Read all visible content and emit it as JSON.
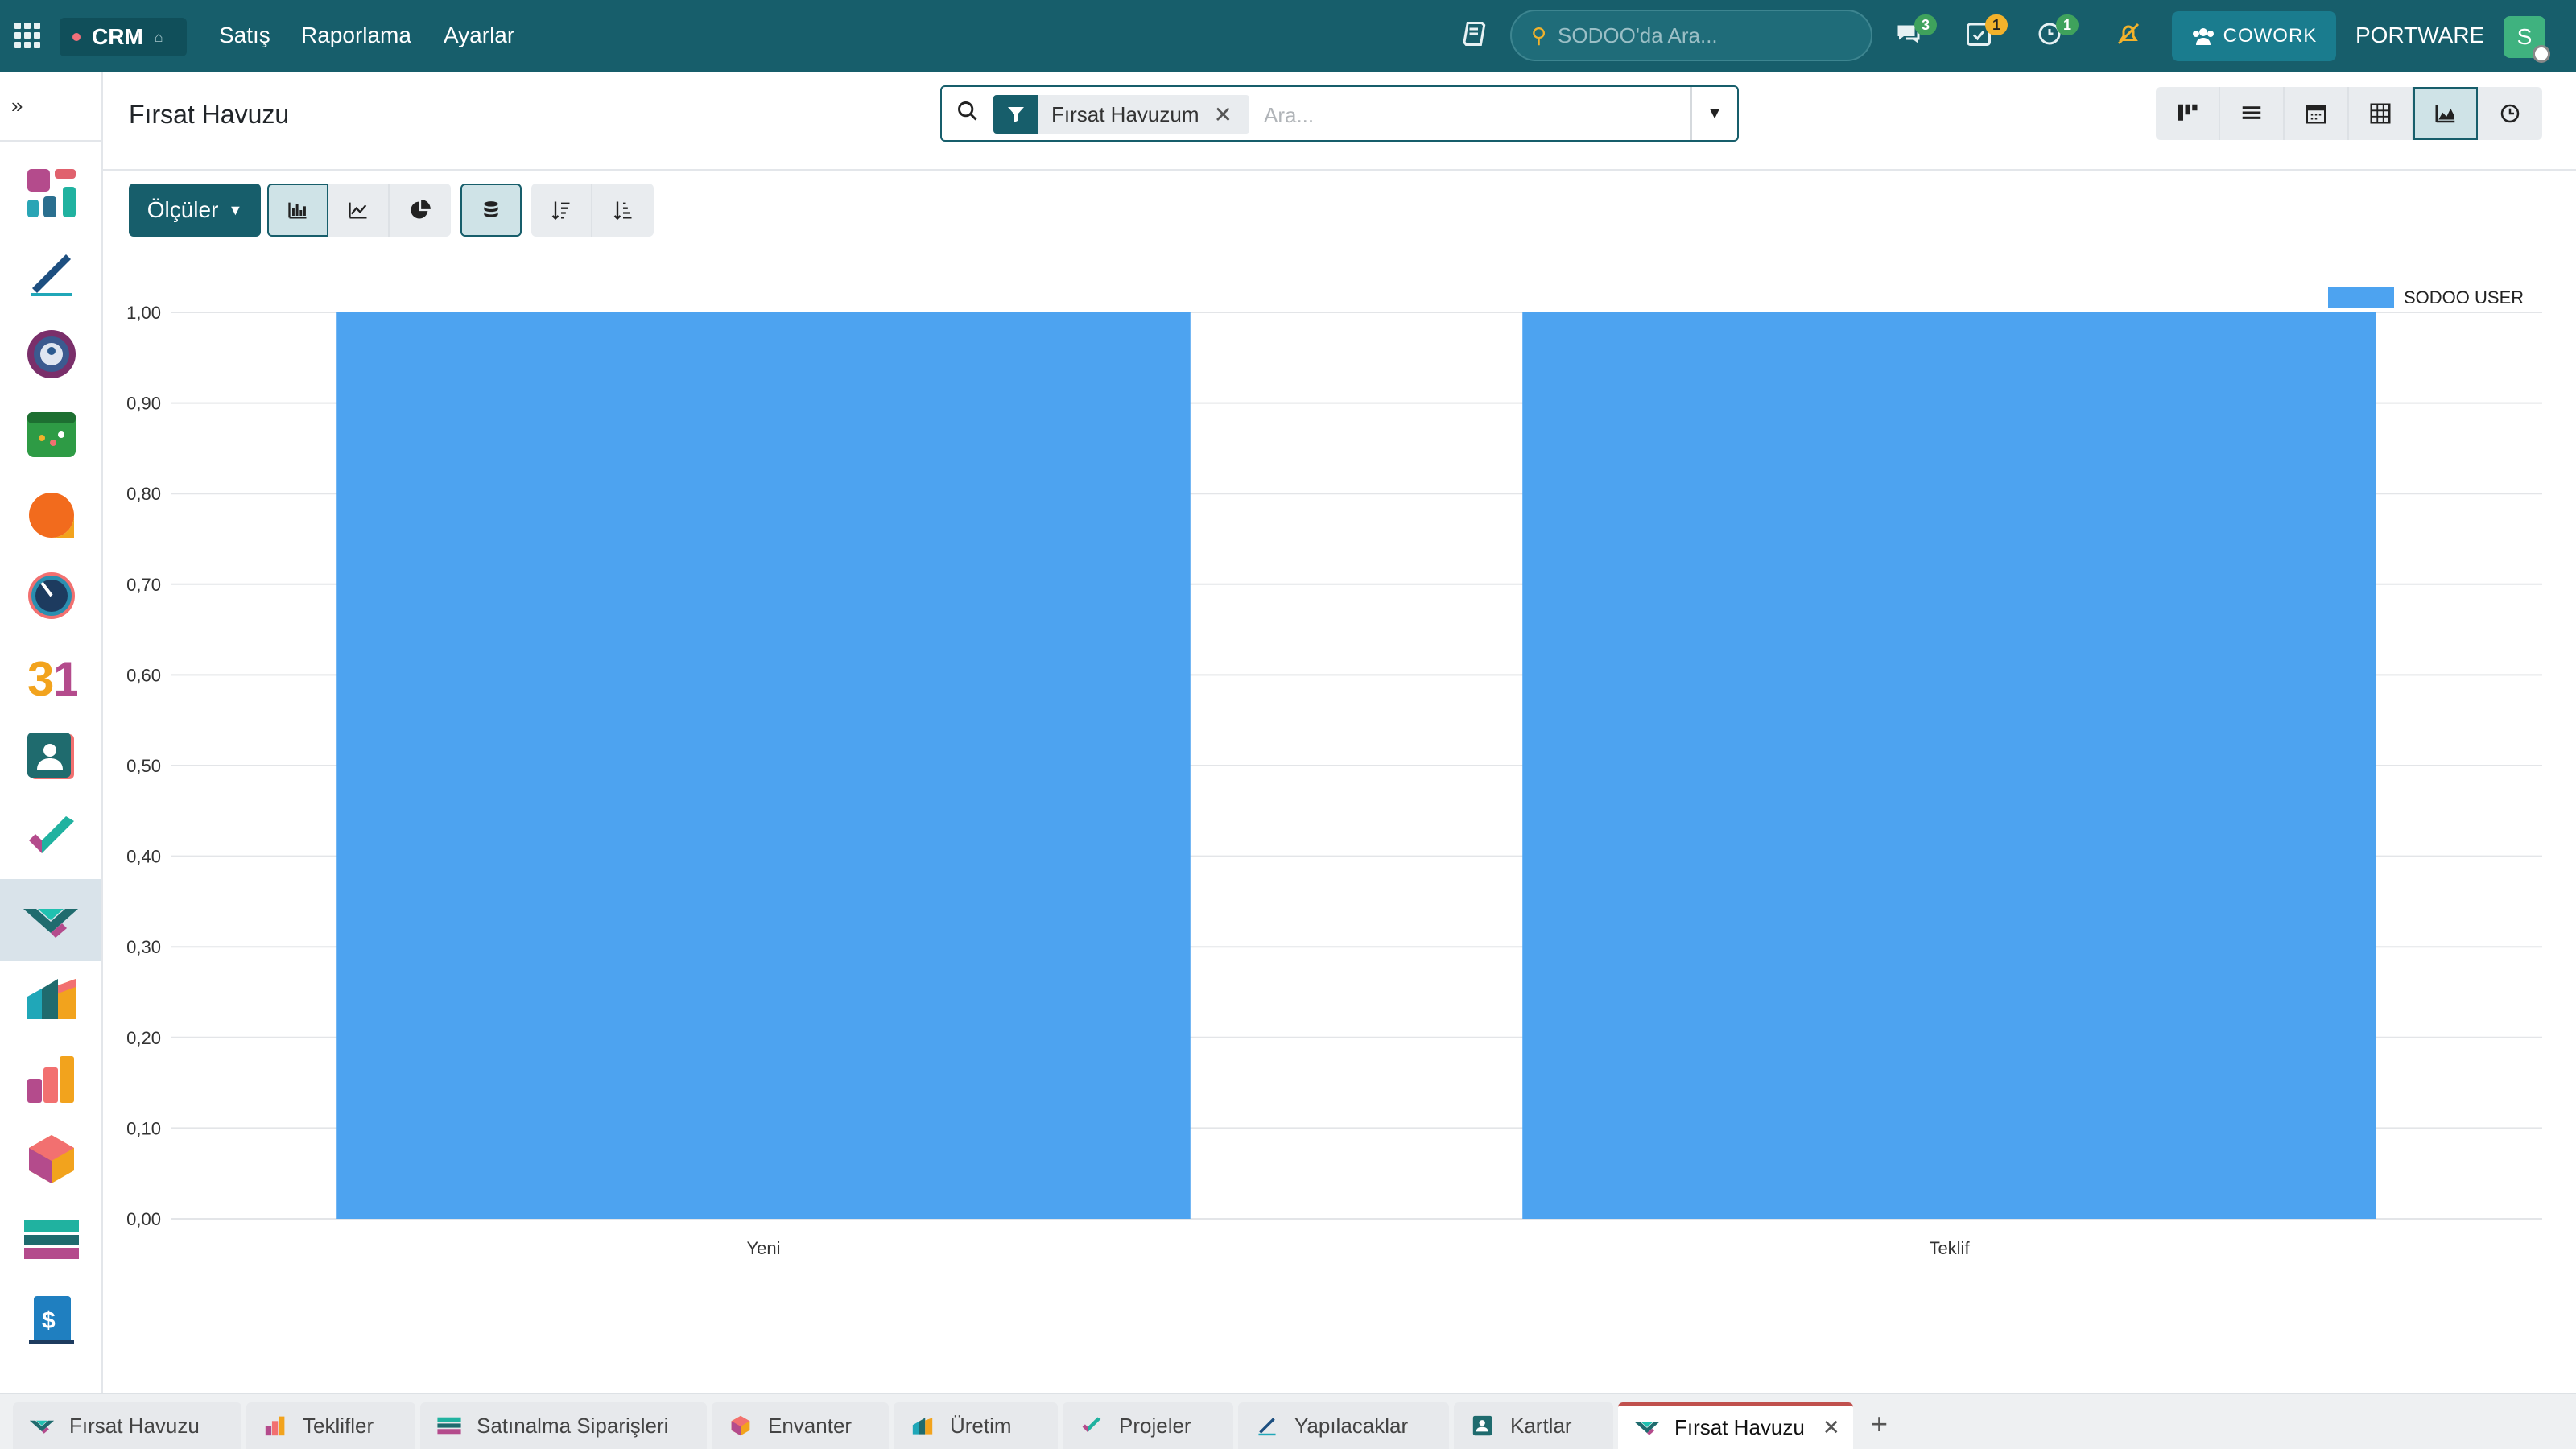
{
  "topbar": {
    "app_name": "CRM",
    "menus": [
      "Satış",
      "Raporlama",
      "Ayarlar"
    ],
    "search_placeholder": "SODOO'da Ara...",
    "messages_count": "3",
    "activities_count": "1",
    "timers_count": "1",
    "cowork_label": "COWORK",
    "company": "PORTWARE",
    "avatar_letter": "S"
  },
  "control_panel": {
    "title": "Fırsat Havuzu",
    "facet_label": "Fırsat Havuzum",
    "search_placeholder": "Ara..."
  },
  "view_switcher": [
    "kanban",
    "list",
    "calendar",
    "pivot",
    "graph",
    "activity"
  ],
  "toolbar": {
    "measures_label": "Ölçüler"
  },
  "chart_data": {
    "type": "bar",
    "categories": [
      "Yeni",
      "Teklif"
    ],
    "series": [
      {
        "name": "SODOO USER",
        "values": [
          1.0,
          1.0
        ],
        "color": "#4da3f0"
      }
    ],
    "ylim": [
      0,
      1.0
    ],
    "yticks": [
      "0,00",
      "0,10",
      "0,20",
      "0,30",
      "0,40",
      "0,50",
      "0,60",
      "0,70",
      "0,80",
      "0,90",
      "1,00"
    ],
    "legend_position": "top-right",
    "grid": true
  },
  "bottom_tabs": [
    {
      "label": "Fırsat Havuzu",
      "icon": "handshake-icon"
    },
    {
      "label": "Teklifler",
      "icon": "bars-icon"
    },
    {
      "label": "Satınalma Siparişleri",
      "icon": "card-icon"
    },
    {
      "label": "Envanter",
      "icon": "box-icon"
    },
    {
      "label": "Üretim",
      "icon": "factory-icon"
    },
    {
      "label": "Projeler",
      "icon": "check-icon"
    },
    {
      "label": "Yapılacaklar",
      "icon": "pen-icon"
    },
    {
      "label": "Kartlar",
      "icon": "contact-icon"
    },
    {
      "label": "Fırsat Havuzu",
      "icon": "handshake-icon",
      "active": true
    }
  ]
}
